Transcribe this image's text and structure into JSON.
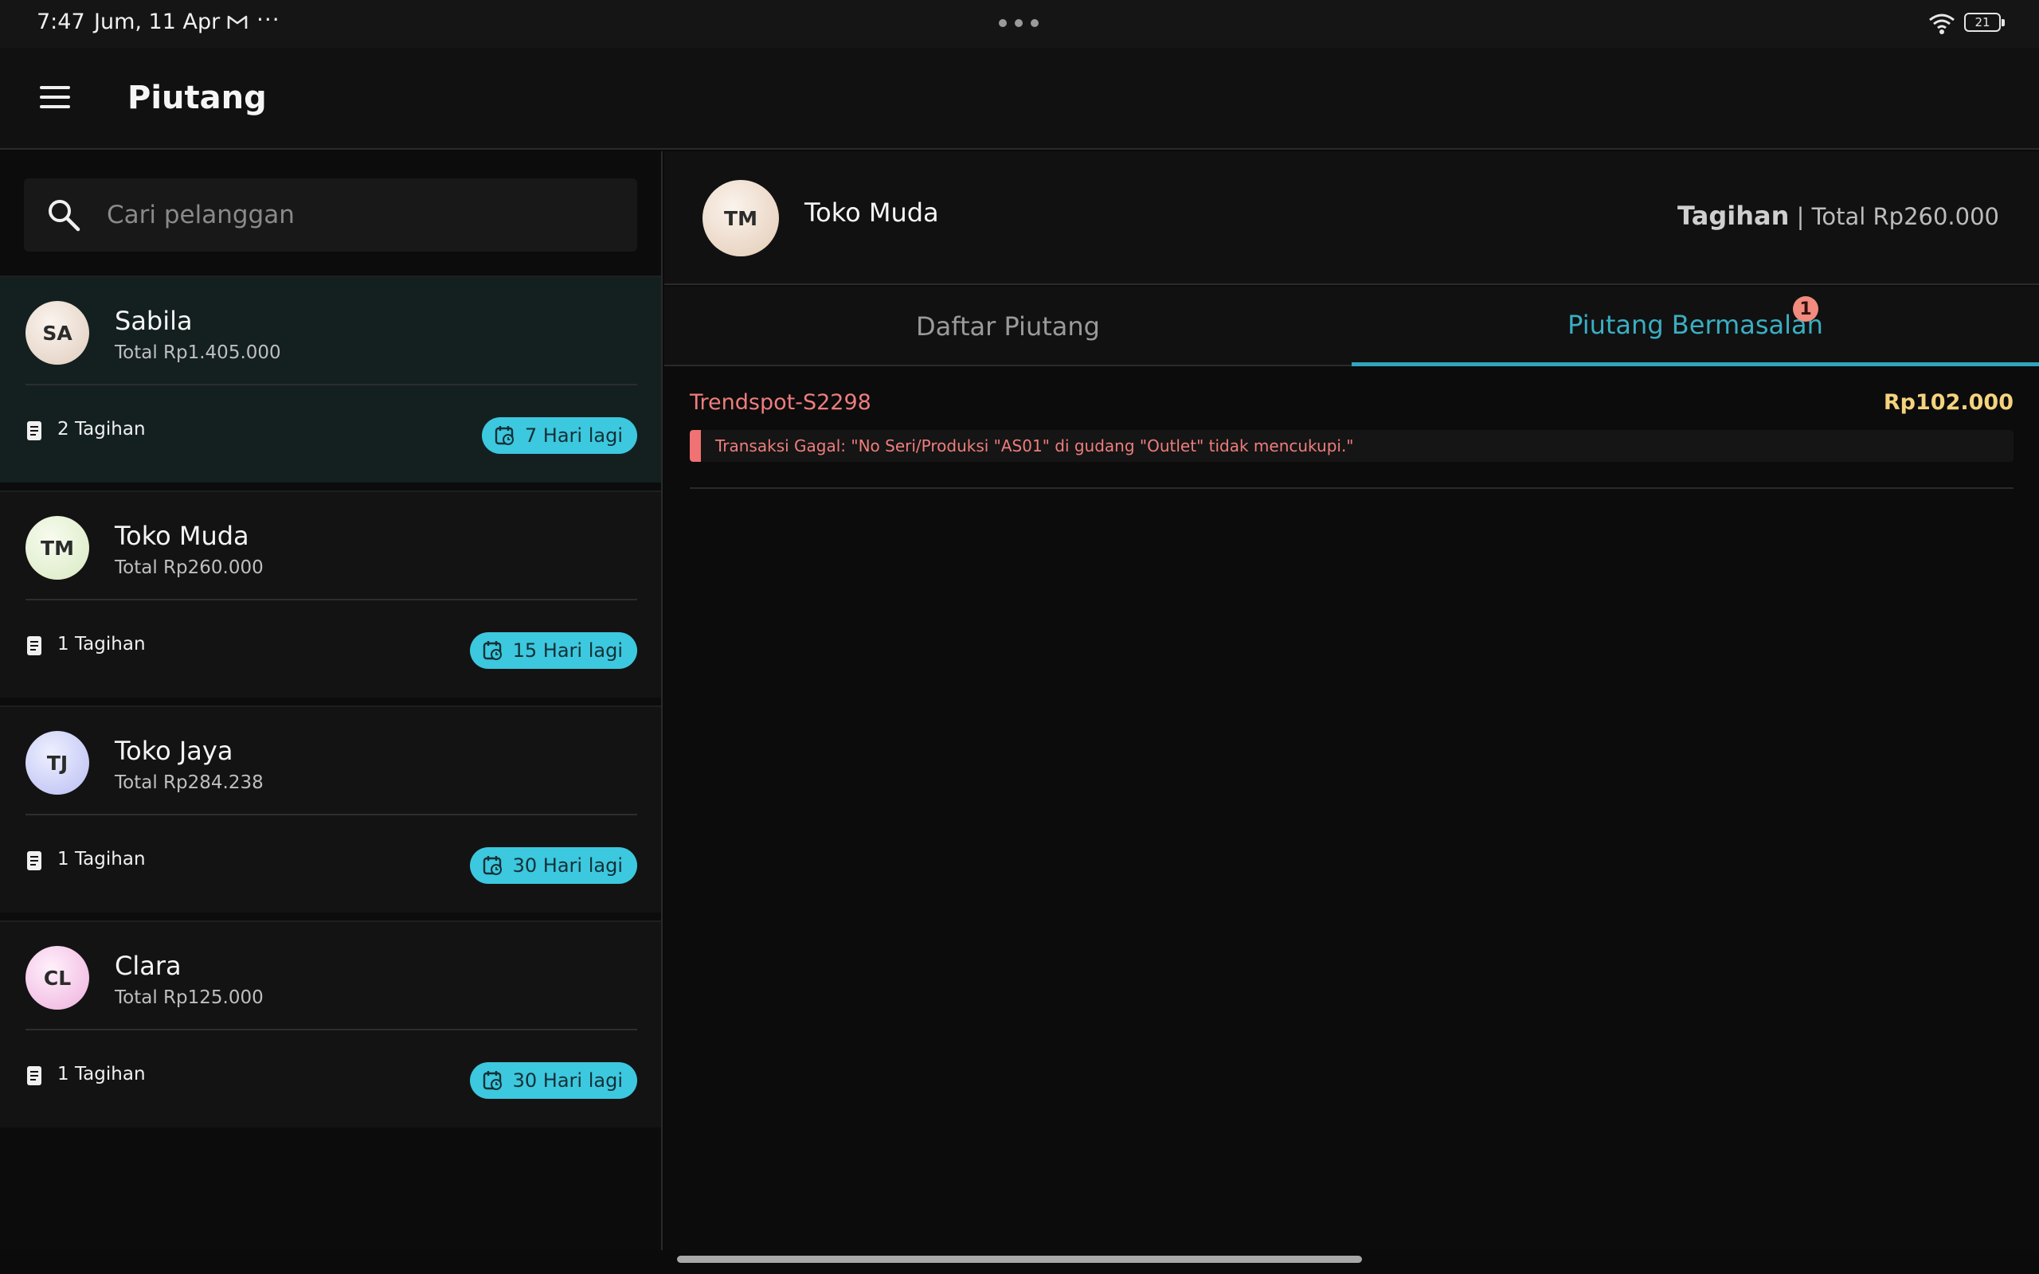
{
  "status_bar": {
    "time": "7:47",
    "date": "Jum, 11 Apr",
    "notification_more": "···",
    "battery": "21"
  },
  "app_bar": {
    "title": "Piutang",
    "menu_icon": "hamburger-menu-icon"
  },
  "search": {
    "placeholder": "Cari pelanggan",
    "value": ""
  },
  "customers": [
    {
      "initials": "SA",
      "name": "Sabila",
      "total": "Total Rp1.405.000",
      "bills": "2 Tagihan",
      "due": "7 Hari lagi",
      "active": true,
      "avatar_color": "#eadfd6"
    },
    {
      "initials": "TM",
      "name": "Toko Muda",
      "total": "Total Rp260.000",
      "bills": "1 Tagihan",
      "due": "15 Hari lagi",
      "active": false,
      "avatar_color": "#e6f2d2"
    },
    {
      "initials": "TJ",
      "name": "Toko Jaya",
      "total": "Total Rp284.238",
      "bills": "1 Tagihan",
      "due": "30 Hari lagi",
      "active": false,
      "avatar_color": "#cdd0f6"
    },
    {
      "initials": "CL",
      "name": "Clara",
      "total": "Total Rp125.000",
      "bills": "1 Tagihan",
      "due": "30 Hari lagi",
      "active": false,
      "avatar_color": "#f4c6e8"
    }
  ],
  "detail": {
    "initials": "TM",
    "name": "Toko Muda",
    "summary_label": "Tagihan",
    "summary_total": "Total Rp260.000",
    "tabs": [
      {
        "label": "Daftar Piutang"
      },
      {
        "label": "Piutang Bermasalah",
        "badge": "1"
      }
    ],
    "transactions": [
      {
        "id": "Trendspot-S2298",
        "amount": "Rp102.000",
        "error": "Transaksi Gagal: \"No Seri/Produksi \"AS01\" di gudang \"Outlet\" tidak mencukupi.\""
      }
    ]
  },
  "colors": {
    "accent": "#3aaec2",
    "badge": "#3cc8de",
    "error": "#ef7d7d",
    "amount": "#f4d37e"
  }
}
